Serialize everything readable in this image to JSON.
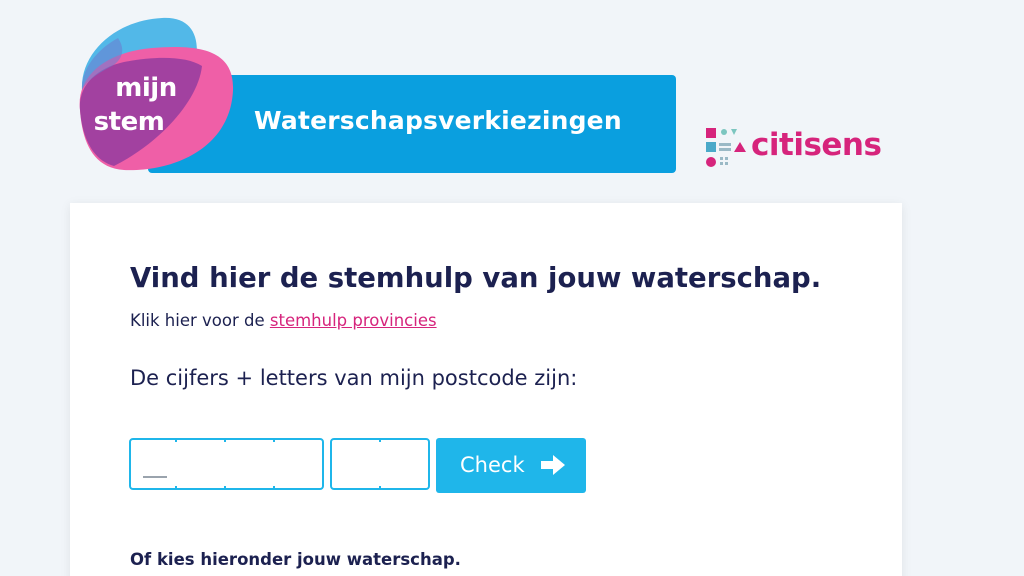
{
  "header": {
    "logo": {
      "line1": "mijn",
      "line2": "stem"
    },
    "banner_title": "Waterschapsverkiezingen",
    "partner_name": "citisens"
  },
  "main": {
    "heading": "Vind hier de stemhulp van jouw waterschap.",
    "intro_text": "Klik hier voor de",
    "intro_link": "stemhulp provincies",
    "postcode_label": "De cijfers + letters van mijn postcode zijn:",
    "check_button": "Check",
    "choose_text": "Of kies hieronder jouw waterschap."
  },
  "colors": {
    "banner_blue": "#0a9fdf",
    "button_blue": "#1fb6ea",
    "brand_pink": "#d6247c",
    "text_navy": "#1c2150"
  },
  "icons": {
    "check_button": "arrow-right-icon",
    "partner": "citisens-mark-icon"
  }
}
